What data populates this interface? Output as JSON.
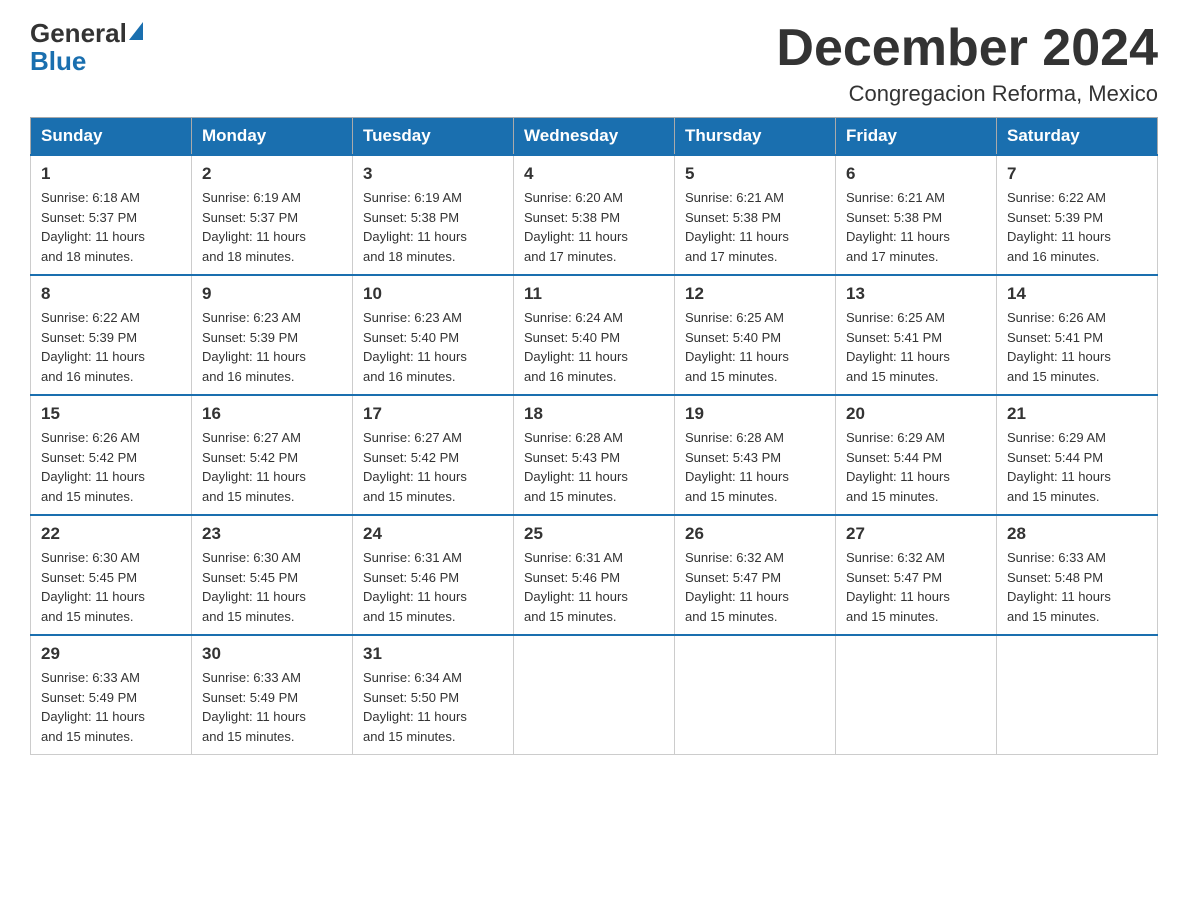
{
  "header": {
    "logo_text_general": "General",
    "logo_text_blue": "Blue",
    "month_title": "December 2024",
    "location": "Congregacion Reforma, Mexico"
  },
  "weekdays": [
    "Sunday",
    "Monday",
    "Tuesday",
    "Wednesday",
    "Thursday",
    "Friday",
    "Saturday"
  ],
  "weeks": [
    [
      {
        "day": "1",
        "sunrise": "6:18 AM",
        "sunset": "5:37 PM",
        "daylight": "11 hours and 18 minutes."
      },
      {
        "day": "2",
        "sunrise": "6:19 AM",
        "sunset": "5:37 PM",
        "daylight": "11 hours and 18 minutes."
      },
      {
        "day": "3",
        "sunrise": "6:19 AM",
        "sunset": "5:38 PM",
        "daylight": "11 hours and 18 minutes."
      },
      {
        "day": "4",
        "sunrise": "6:20 AM",
        "sunset": "5:38 PM",
        "daylight": "11 hours and 17 minutes."
      },
      {
        "day": "5",
        "sunrise": "6:21 AM",
        "sunset": "5:38 PM",
        "daylight": "11 hours and 17 minutes."
      },
      {
        "day": "6",
        "sunrise": "6:21 AM",
        "sunset": "5:38 PM",
        "daylight": "11 hours and 17 minutes."
      },
      {
        "day": "7",
        "sunrise": "6:22 AM",
        "sunset": "5:39 PM",
        "daylight": "11 hours and 16 minutes."
      }
    ],
    [
      {
        "day": "8",
        "sunrise": "6:22 AM",
        "sunset": "5:39 PM",
        "daylight": "11 hours and 16 minutes."
      },
      {
        "day": "9",
        "sunrise": "6:23 AM",
        "sunset": "5:39 PM",
        "daylight": "11 hours and 16 minutes."
      },
      {
        "day": "10",
        "sunrise": "6:23 AM",
        "sunset": "5:40 PM",
        "daylight": "11 hours and 16 minutes."
      },
      {
        "day": "11",
        "sunrise": "6:24 AM",
        "sunset": "5:40 PM",
        "daylight": "11 hours and 16 minutes."
      },
      {
        "day": "12",
        "sunrise": "6:25 AM",
        "sunset": "5:40 PM",
        "daylight": "11 hours and 15 minutes."
      },
      {
        "day": "13",
        "sunrise": "6:25 AM",
        "sunset": "5:41 PM",
        "daylight": "11 hours and 15 minutes."
      },
      {
        "day": "14",
        "sunrise": "6:26 AM",
        "sunset": "5:41 PM",
        "daylight": "11 hours and 15 minutes."
      }
    ],
    [
      {
        "day": "15",
        "sunrise": "6:26 AM",
        "sunset": "5:42 PM",
        "daylight": "11 hours and 15 minutes."
      },
      {
        "day": "16",
        "sunrise": "6:27 AM",
        "sunset": "5:42 PM",
        "daylight": "11 hours and 15 minutes."
      },
      {
        "day": "17",
        "sunrise": "6:27 AM",
        "sunset": "5:42 PM",
        "daylight": "11 hours and 15 minutes."
      },
      {
        "day": "18",
        "sunrise": "6:28 AM",
        "sunset": "5:43 PM",
        "daylight": "11 hours and 15 minutes."
      },
      {
        "day": "19",
        "sunrise": "6:28 AM",
        "sunset": "5:43 PM",
        "daylight": "11 hours and 15 minutes."
      },
      {
        "day": "20",
        "sunrise": "6:29 AM",
        "sunset": "5:44 PM",
        "daylight": "11 hours and 15 minutes."
      },
      {
        "day": "21",
        "sunrise": "6:29 AM",
        "sunset": "5:44 PM",
        "daylight": "11 hours and 15 minutes."
      }
    ],
    [
      {
        "day": "22",
        "sunrise": "6:30 AM",
        "sunset": "5:45 PM",
        "daylight": "11 hours and 15 minutes."
      },
      {
        "day": "23",
        "sunrise": "6:30 AM",
        "sunset": "5:45 PM",
        "daylight": "11 hours and 15 minutes."
      },
      {
        "day": "24",
        "sunrise": "6:31 AM",
        "sunset": "5:46 PM",
        "daylight": "11 hours and 15 minutes."
      },
      {
        "day": "25",
        "sunrise": "6:31 AM",
        "sunset": "5:46 PM",
        "daylight": "11 hours and 15 minutes."
      },
      {
        "day": "26",
        "sunrise": "6:32 AM",
        "sunset": "5:47 PM",
        "daylight": "11 hours and 15 minutes."
      },
      {
        "day": "27",
        "sunrise": "6:32 AM",
        "sunset": "5:47 PM",
        "daylight": "11 hours and 15 minutes."
      },
      {
        "day": "28",
        "sunrise": "6:33 AM",
        "sunset": "5:48 PM",
        "daylight": "11 hours and 15 minutes."
      }
    ],
    [
      {
        "day": "29",
        "sunrise": "6:33 AM",
        "sunset": "5:49 PM",
        "daylight": "11 hours and 15 minutes."
      },
      {
        "day": "30",
        "sunrise": "6:33 AM",
        "sunset": "5:49 PM",
        "daylight": "11 hours and 15 minutes."
      },
      {
        "day": "31",
        "sunrise": "6:34 AM",
        "sunset": "5:50 PM",
        "daylight": "11 hours and 15 minutes."
      },
      null,
      null,
      null,
      null
    ]
  ],
  "labels": {
    "sunrise": "Sunrise:",
    "sunset": "Sunset:",
    "daylight": "Daylight:"
  }
}
